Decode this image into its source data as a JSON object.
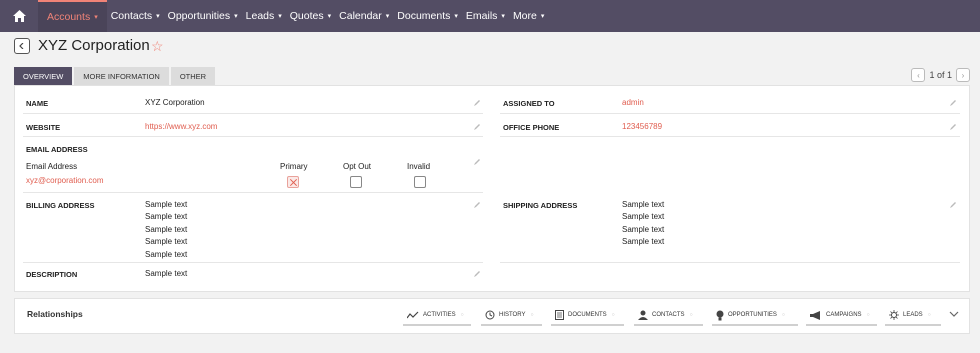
{
  "nav": {
    "items": [
      {
        "label": "Accounts",
        "active": true
      },
      {
        "label": "Contacts",
        "active": false
      },
      {
        "label": "Opportunities",
        "active": false
      },
      {
        "label": "Leads",
        "active": false
      },
      {
        "label": "Quotes",
        "active": false
      },
      {
        "label": "Calendar",
        "active": false
      },
      {
        "label": "Documents",
        "active": false
      },
      {
        "label": "Emails",
        "active": false
      },
      {
        "label": "More",
        "active": false
      }
    ],
    "caret": "▾"
  },
  "header": {
    "title": "XYZ Corporation",
    "star": "☆"
  },
  "tabs": [
    "OVERVIEW",
    "MORE INFORMATION",
    "OTHER"
  ],
  "pager": {
    "text": "1 of 1",
    "prev": "‹",
    "next": "›"
  },
  "fields": {
    "name": {
      "label": "NAME",
      "value": "XYZ Corporation"
    },
    "assigned_to": {
      "label": "ASSIGNED TO",
      "value": "admin"
    },
    "website": {
      "label": "WEBSITE",
      "value": "https://www.xyz.com"
    },
    "office_phone": {
      "label": "OFFICE PHONE",
      "value": "123456789"
    },
    "email": {
      "label": "EMAIL ADDRESS",
      "col_email": "Email Address",
      "col_primary": "Primary",
      "col_optout": "Opt Out",
      "col_invalid": "Invalid",
      "value": "xyz@corporation.com"
    },
    "billing": {
      "label": "BILLING ADDRESS",
      "lines": [
        "Sample text",
        "Sample text",
        "Sample text",
        "Sample text",
        "Sample text"
      ]
    },
    "shipping": {
      "label": "SHIPPING ADDRESS",
      "lines": [
        "Sample text",
        "Sample text",
        "Sample text",
        "Sample text"
      ]
    },
    "description": {
      "label": "DESCRIPTION",
      "value": "Sample text"
    }
  },
  "relationships": {
    "title": "Relationships",
    "items": [
      {
        "label": "ACTIVITIES",
        "icon": "activity-icon"
      },
      {
        "label": "HISTORY",
        "icon": "history-icon"
      },
      {
        "label": "DOCUMENTS",
        "icon": "document-icon"
      },
      {
        "label": "CONTACTS",
        "icon": "contact-icon"
      },
      {
        "label": "OPPORTUNITIES",
        "icon": "lightbulb-icon"
      },
      {
        "label": "CAMPAIGNS",
        "icon": "megaphone-icon"
      },
      {
        "label": "LEADS",
        "icon": "leads-icon"
      }
    ]
  },
  "colors": {
    "accent": "#f08377",
    "nav_bg": "#534d64",
    "link": "#e05d4f"
  }
}
